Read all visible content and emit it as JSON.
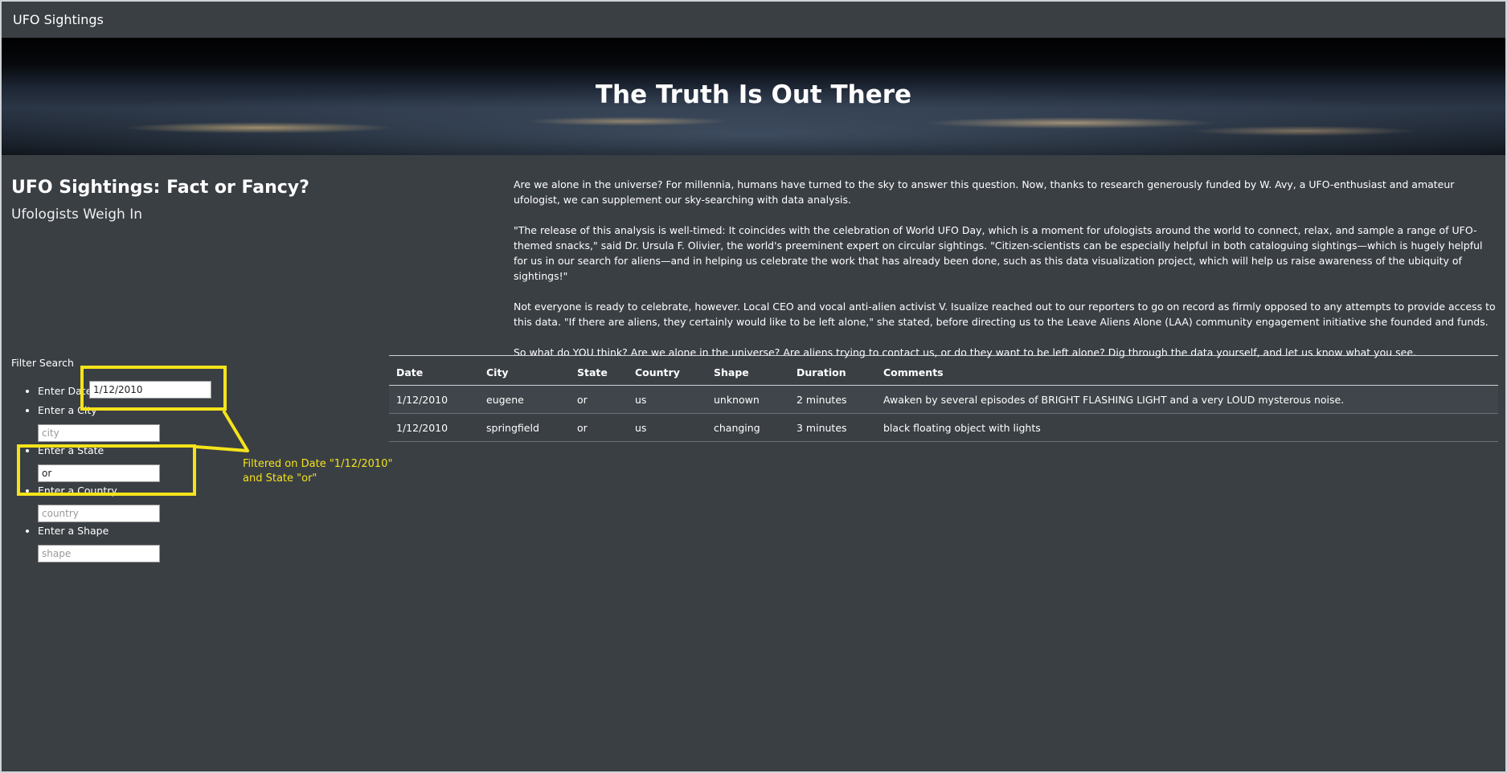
{
  "navbar": {
    "brand": "UFO Sightings"
  },
  "hero": {
    "title": "The Truth Is Out There"
  },
  "intro": {
    "title": "UFO Sightings: Fact or Fancy?",
    "subtitle": "Ufologists Weigh In"
  },
  "article": {
    "paragraphs": [
      "Are we alone in the universe? For millennia, humans have turned to the sky to answer this question. Now, thanks to research generously funded by W. Avy, a UFO-enthusiast and amateur ufologist, we can supplement our sky-searching with data analysis.",
      "\"The release of this analysis is well-timed: It coincides with the celebration of World UFO Day, which is a moment for ufologists around the world to connect, relax, and sample a range of UFO-themed snacks,\" said Dr. Ursula F. Olivier, the world's preeminent expert on circular sightings. \"Citizen-scientists can be especially helpful in both cataloguing sightings—which is hugely helpful for us in our search for aliens—and in helping us celebrate the work that has already been done, such as this data visualization project, which will help us raise awareness of the ubiquity of sightings!\"",
      "Not everyone is ready to celebrate, however. Local CEO and vocal anti-alien activist V. Isualize reached out to our reporters to go on record as firmly opposed to any attempts to provide access to this data. \"If there are aliens, they certainly would like to be left alone,\" she stated, before directing us to the Leave Aliens Alone (LAA) community engagement initiative she founded and funds.",
      "So what do YOU think? Are we alone in the universe? Are aliens trying to contact us, or do they want to be left alone? Dig through the data yourself, and let us know what you see."
    ]
  },
  "filters": {
    "title": "Filter Search",
    "date": {
      "label": "Enter Date",
      "value": "1/12/2010",
      "placeholder": ""
    },
    "city": {
      "label": "Enter a City",
      "value": "",
      "placeholder": "city"
    },
    "state": {
      "label": "Enter a State",
      "value": "or",
      "placeholder": ""
    },
    "country": {
      "label": "Enter a Country",
      "value": "",
      "placeholder": "country"
    },
    "shape": {
      "label": "Enter a Shape",
      "value": "",
      "placeholder": "shape"
    }
  },
  "annotation": {
    "color": "#f5e31a",
    "line1": "Filtered on Date \"1/12/2010\"",
    "line2": "and State \"or\""
  },
  "table": {
    "headers": [
      "Date",
      "City",
      "State",
      "Country",
      "Shape",
      "Duration",
      "Comments"
    ],
    "rows": [
      [
        "1/12/2010",
        "eugene",
        "or",
        "us",
        "unknown",
        "2 minutes",
        "Awaken by several episodes of BRIGHT FLASHING LIGHT and a very LOUD mysterous noise."
      ],
      [
        "1/12/2010",
        "springfield",
        "or",
        "us",
        "changing",
        "3 minutes",
        "black floating object with lights"
      ]
    ]
  },
  "colors": {
    "background": "#3a3f44",
    "text": "#ffffff"
  }
}
